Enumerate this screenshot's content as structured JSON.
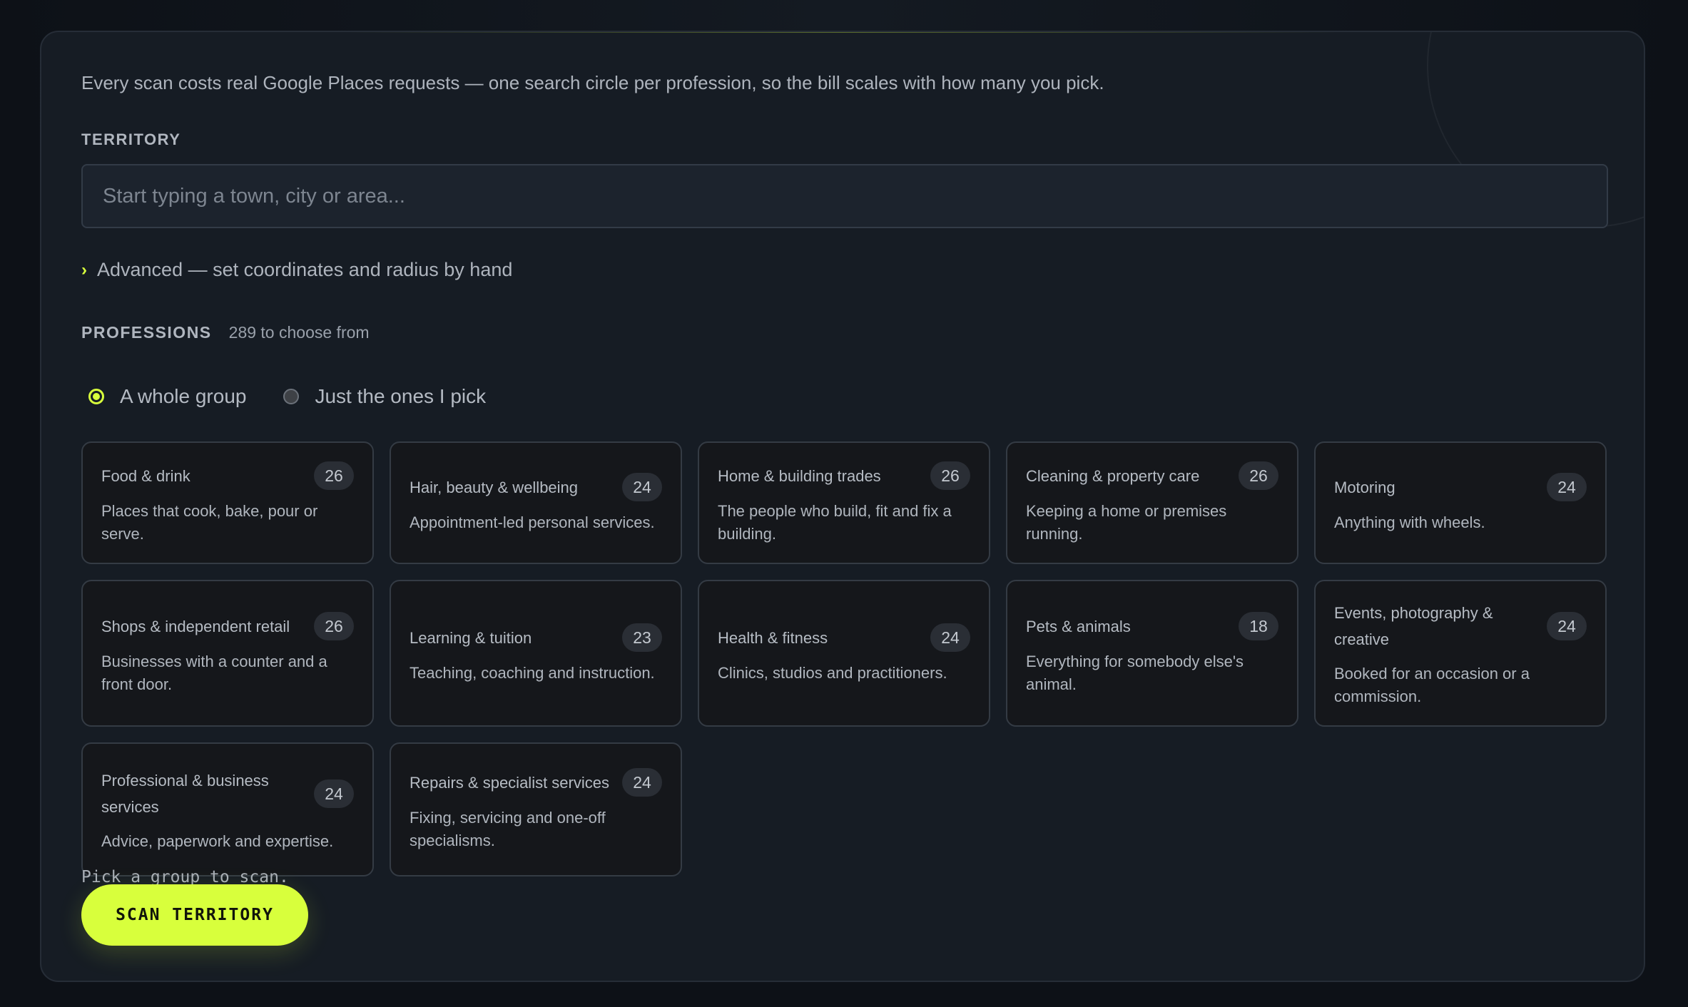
{
  "intro": "Every scan costs real Google Places requests — one search circle per profession, so the bill scales with how many you pick.",
  "territory": {
    "label": "TERRITORY",
    "placeholder": "Start typing a town, city or area...",
    "value": ""
  },
  "advanced": {
    "chevron": "›",
    "label": "Advanced — set coordinates and radius by hand"
  },
  "professions": {
    "label": "PROFESSIONS",
    "count_text": "289 to choose from",
    "modes": [
      {
        "label": "A whole group",
        "selected": true
      },
      {
        "label": "Just the ones I pick",
        "selected": false
      }
    ],
    "groups": [
      {
        "title": "Food & drink",
        "count": "26",
        "desc": "Places that cook, bake, pour or serve."
      },
      {
        "title": "Hair, beauty & wellbeing",
        "count": "24",
        "desc": "Appointment-led personal services."
      },
      {
        "title": "Home & building trades",
        "count": "26",
        "desc": "The people who build, fit and fix a building."
      },
      {
        "title": "Cleaning & property care",
        "count": "26",
        "desc": "Keeping a home or premises running."
      },
      {
        "title": "Motoring",
        "count": "24",
        "desc": "Anything with wheels."
      },
      {
        "title": "Shops & independent retail",
        "count": "26",
        "desc": "Businesses with a counter and a front door."
      },
      {
        "title": "Learning & tuition",
        "count": "23",
        "desc": "Teaching, coaching and instruction."
      },
      {
        "title": "Health & fitness",
        "count": "24",
        "desc": "Clinics, studios and practitioners."
      },
      {
        "title": "Pets & animals",
        "count": "18",
        "desc": "Everything for somebody else's animal."
      },
      {
        "title": "Events, photography & creative",
        "count": "24",
        "desc": "Booked for an occasion or a commission."
      },
      {
        "title": "Professional & business services",
        "count": "24",
        "desc": "Advice, paperwork and expertise."
      },
      {
        "title": "Repairs & specialist services",
        "count": "24",
        "desc": "Fixing, servicing and one-off specialisms."
      }
    ]
  },
  "status": "Pick a group to scan.",
  "scan_button": "SCAN TERRITORY",
  "colors": {
    "accent": "#d8ff3c",
    "panel": "#161c24",
    "card": "#15171b"
  }
}
